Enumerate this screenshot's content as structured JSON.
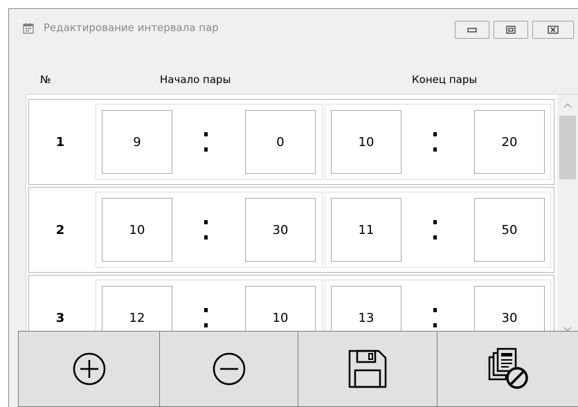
{
  "window": {
    "title": "Редактирование интервала пар",
    "icon": "calendar-icon",
    "controls": [
      "minimize-icon",
      "maximize-icon",
      "close-icon"
    ]
  },
  "headers": {
    "number": "№",
    "start": "Начало пары",
    "end": "Конец пары"
  },
  "separator": ":",
  "rows": [
    {
      "num": "1",
      "start_h": "9",
      "start_m": "0",
      "end_h": "10",
      "end_m": "20"
    },
    {
      "num": "2",
      "start_h": "10",
      "start_m": "30",
      "end_h": "11",
      "end_m": "50"
    },
    {
      "num": "3",
      "start_h": "12",
      "start_m": "10",
      "end_h": "13",
      "end_m": "30"
    }
  ],
  "toolbar": {
    "buttons": [
      "add-circle-icon",
      "remove-circle-icon",
      "save-floppy-icon",
      "clear-list-icon"
    ]
  },
  "colors": {
    "window_bg": "#f0f0f0",
    "button_bg": "#e1e1e1",
    "border": "#7a7a7a",
    "title_text": "#8a8a8a"
  }
}
